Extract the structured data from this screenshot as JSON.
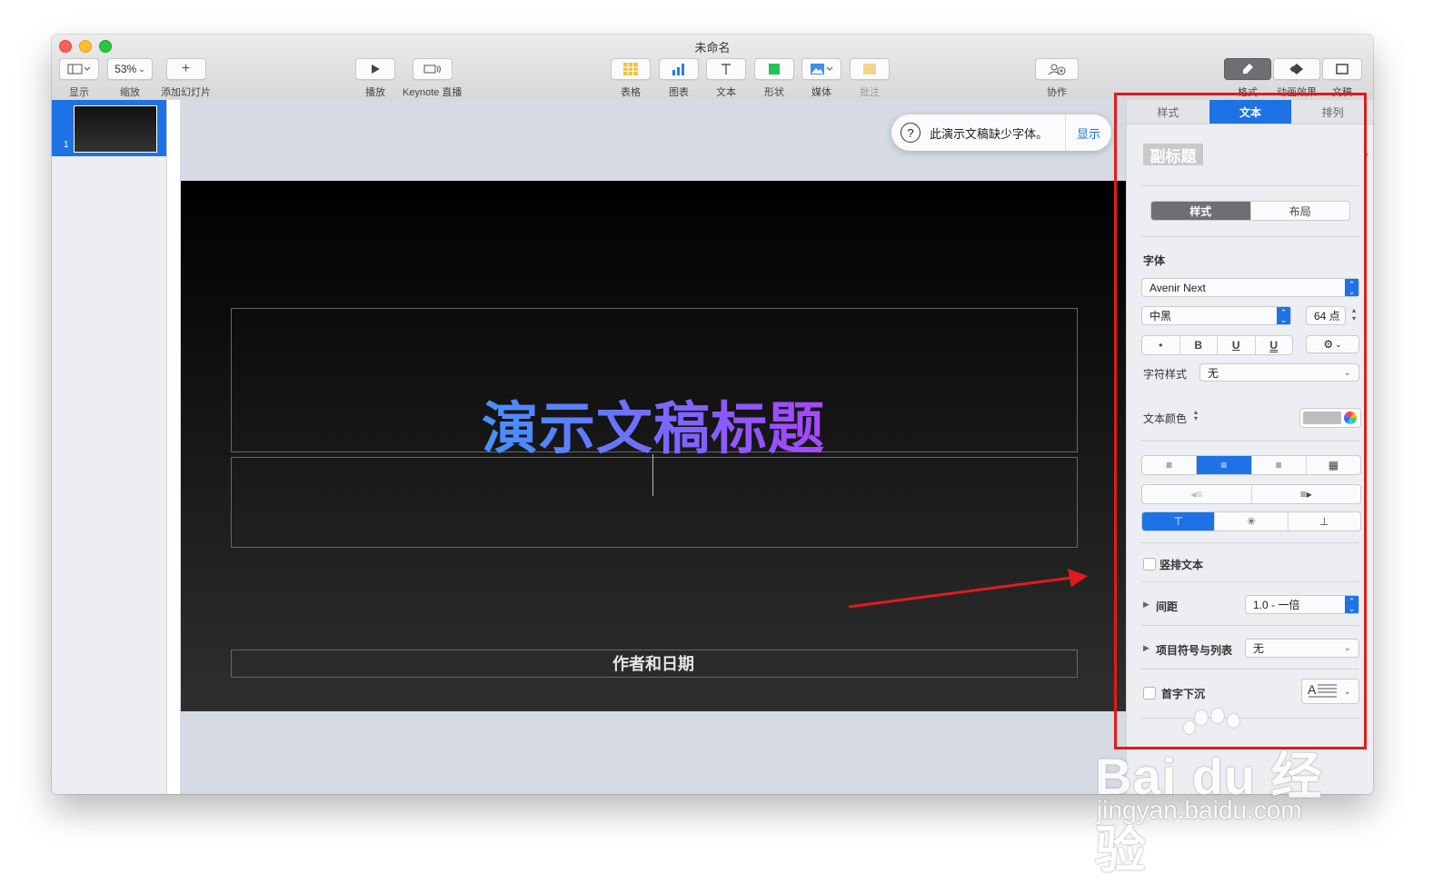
{
  "window": {
    "title": "未命名"
  },
  "toolbar": {
    "view_label": "显示",
    "zoom_value": "53%",
    "zoom_label": "缩放",
    "add_slide_label": "添加幻灯片",
    "play_label": "播放",
    "keynote_live_label": "Keynote 直播",
    "table_label": "表格",
    "chart_label": "图表",
    "text_label": "文本",
    "shape_label": "形状",
    "media_label": "媒体",
    "comment_label": "批注",
    "collaborate_label": "协作",
    "format_label": "格式",
    "animate_label": "动画效果",
    "document_label": "文稿"
  },
  "navigator": {
    "slides": [
      {
        "number": "1"
      }
    ]
  },
  "notice": {
    "text": "此演示文稿缺少字体。",
    "button": "显示"
  },
  "slide": {
    "title": "演示文稿标题",
    "subtitle": "作者和日期"
  },
  "inspector": {
    "tabs": [
      "样式",
      "文本",
      "排列"
    ],
    "active_tab": "文本",
    "paragraph_style": "副标题",
    "subtabs": [
      "样式",
      "布局"
    ],
    "font_section": "字体",
    "font_family": "Avenir Next",
    "font_weight": "中黑",
    "font_size": "64 点",
    "format_buttons": [
      "•",
      "B",
      "U",
      "U"
    ],
    "char_style_label": "字符样式",
    "char_style_value": "无",
    "text_color_label": "文本颜色",
    "text_color_swatch": "#bdbdbd",
    "vertical_text_label": "竖排文本",
    "spacing_label": "间距",
    "spacing_value": "1.0 - 一倍",
    "bullets_label": "项目符号与列表",
    "bullets_value": "无",
    "dropcap_label": "首字下沉"
  },
  "watermark": {
    "brand": "Bai du 经验",
    "url": "jingyan.baidu.com"
  },
  "colors": {
    "accent": "#1d73e6",
    "annotation": "#e01b1b"
  }
}
